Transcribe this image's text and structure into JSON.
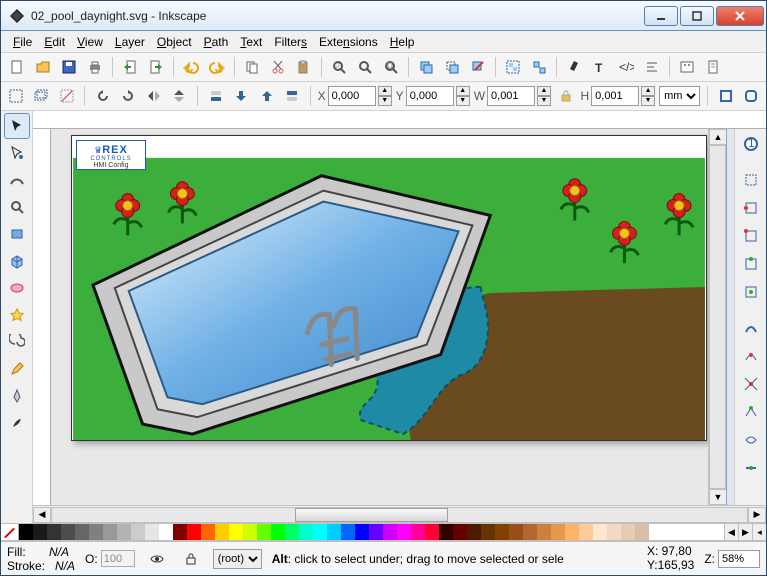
{
  "window": {
    "title": "02_pool_daynight.svg - Inkscape"
  },
  "menu": {
    "file": "File",
    "edit": "Edit",
    "view": "View",
    "layer": "Layer",
    "object": "Object",
    "path": "Path",
    "text": "Text",
    "filters": "Filters",
    "extensions": "Extensions",
    "help": "Help"
  },
  "coords": {
    "x_label": "X",
    "x": "0,000",
    "y_label": "Y",
    "y": "0,000",
    "w_label": "W",
    "w": "0,001",
    "h_label": "H",
    "h": "0,001",
    "unit": "mm"
  },
  "rex": {
    "brand": "REX",
    "sub1": "CONTROLS",
    "sub2": "HMI Config"
  },
  "palette": [
    "#000000",
    "#1a1a1a",
    "#333333",
    "#4d4d4d",
    "#666666",
    "#808080",
    "#999999",
    "#b3b3b3",
    "#cccccc",
    "#e6e6e6",
    "#ffffff",
    "#800000",
    "#ff0000",
    "#ff6600",
    "#ffcc00",
    "#ffff00",
    "#ccff00",
    "#66ff00",
    "#00ff00",
    "#00ff66",
    "#00ffcc",
    "#00ffff",
    "#00ccff",
    "#0066ff",
    "#0000ff",
    "#6600ff",
    "#cc00ff",
    "#ff00ff",
    "#ff0099",
    "#ff0033",
    "#330000",
    "#660000",
    "#4d1a00",
    "#663300",
    "#804000",
    "#994d1a",
    "#b36633",
    "#cc8040",
    "#e6994d",
    "#ffb366",
    "#ffcc99",
    "#ffe6cc",
    "#f2d9c6",
    "#e6ccb3",
    "#d9bfa6"
  ],
  "status": {
    "fill_label": "Fill:",
    "fill_value": "N/A",
    "stroke_label": "Stroke:",
    "stroke_value": "N/A",
    "opacity_label": "O:",
    "opacity_value": "100",
    "layer": "(root)",
    "hint_prefix": "Alt",
    "hint_rest": ": click to select under; drag to move selected or sele",
    "cursor_x_label": "X:",
    "cursor_x": " 97,80",
    "cursor_y_label": "Y:",
    "cursor_y": "165,93",
    "zoom_label": "Z:",
    "zoom": "58%"
  }
}
